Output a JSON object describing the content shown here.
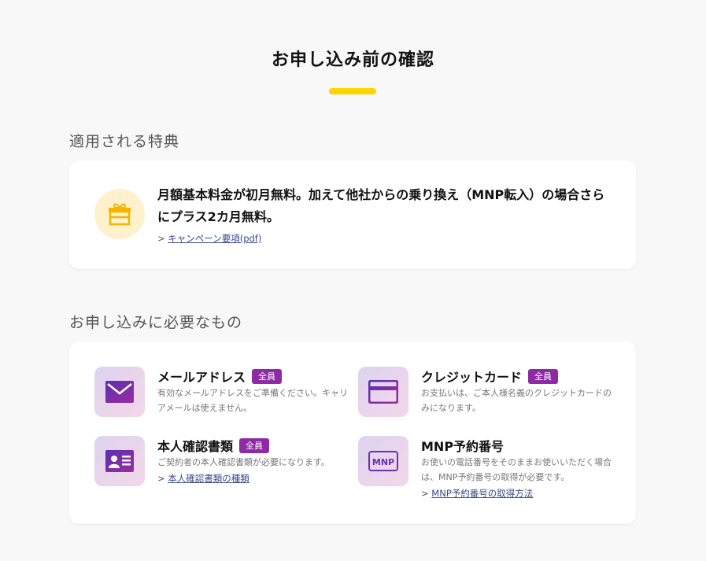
{
  "page": {
    "title": "お申し込み前の確認"
  },
  "benefits": {
    "heading": "適用される特典",
    "text": "月額基本料金が初月無料。加えて他社からの乗り換え（MNP転入）の場合さらにプラス2カ月無料。",
    "link_prefix": ">",
    "link_label": "キャンペーン要項(pdf)",
    "icon": "gift-icon"
  },
  "requirements": {
    "heading": "お申し込みに必要なもの",
    "items": [
      {
        "title": "メールアドレス",
        "badge": "全員",
        "description": "有効なメールアドレスをご準備ください。キャリアメールは使えません。",
        "icon": "mail-icon"
      },
      {
        "title": "クレジットカード",
        "badge": "全員",
        "description": "お支払いは、ご本人様名義のクレジットカードのみになります。",
        "icon": "credit-card-icon"
      },
      {
        "title": "本人確認書類",
        "badge": "全員",
        "description": "ご契約者の本人確認書類が必要になります。",
        "link_prefix": ">",
        "link_label": "本人確認書類の種類",
        "icon": "id-card-icon"
      },
      {
        "title": "MNP予約番号",
        "description": "お使いの電話番号をそのままお使いいただく場合は、MNP予約番号の取得が必要です。",
        "link_prefix": ">",
        "link_label": "MNP予約番号の取得方法",
        "icon": "mnp-icon"
      }
    ]
  },
  "colors": {
    "accent_yellow": "#ffd400",
    "badge_purple": "#8e2aa6",
    "icon_purple": "#6b2fb3",
    "gift_orange": "#f5b400"
  }
}
